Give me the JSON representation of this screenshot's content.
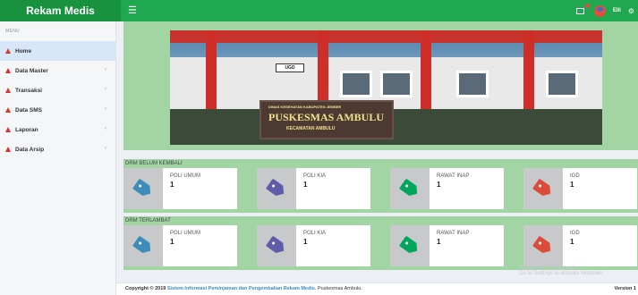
{
  "app": {
    "brand": "Rekam Medis"
  },
  "header": {
    "menu_icon": "hamburger-icon",
    "notification_icon": "flag-icon",
    "user_name": "Elli",
    "settings_icon": "gear-icon"
  },
  "sidebar": {
    "header": "MENU",
    "items": [
      {
        "label": "Home",
        "active": true
      },
      {
        "label": "Data Master"
      },
      {
        "label": "Transaksi"
      },
      {
        "label": "Data SMS"
      },
      {
        "label": "Laporan"
      },
      {
        "label": "Data Arsip"
      }
    ],
    "chevron": "‹"
  },
  "banner": {
    "sign": "UGD",
    "plaque_top": "DINAS KESEHATAN KABUPATEN JEMBER",
    "plaque_main": "PUSKESMAS AMBULU",
    "plaque_sub": "KECAMATAN AMBULU"
  },
  "sections": [
    {
      "title": "DRM BELUM KEMBALI",
      "cards": [
        {
          "label": "POLI UMUM",
          "value": "1",
          "color": "#3c8dbc"
        },
        {
          "label": "POLI KIA",
          "value": "1",
          "color": "#605ca8"
        },
        {
          "label": "RAWAT INAP",
          "value": "1",
          "color": "#00a65a"
        },
        {
          "label": "IGD",
          "value": "1",
          "color": "#dd4b39"
        }
      ]
    },
    {
      "title": "DRM TERLAMBAT",
      "cards": [
        {
          "label": "POLI UMUM",
          "value": "1",
          "color": "#3c8dbc"
        },
        {
          "label": "POLI KIA",
          "value": "1",
          "color": "#605ca8"
        },
        {
          "label": "RAWAT INAP",
          "value": "1",
          "color": "#00a65a"
        },
        {
          "label": "IGD",
          "value": "1",
          "color": "#dd4b39"
        }
      ]
    }
  ],
  "footer": {
    "copyright": "Copyright © 2019",
    "link_text": "Sistem Informasi Peminjaman dan Pengembalian Rekam Medis.",
    "org": "Puskesmas Ambulu.",
    "version": "Version 1"
  },
  "watermark": {
    "line1": "Activate Windows",
    "line2": "Go to Settings to activate Windows."
  }
}
